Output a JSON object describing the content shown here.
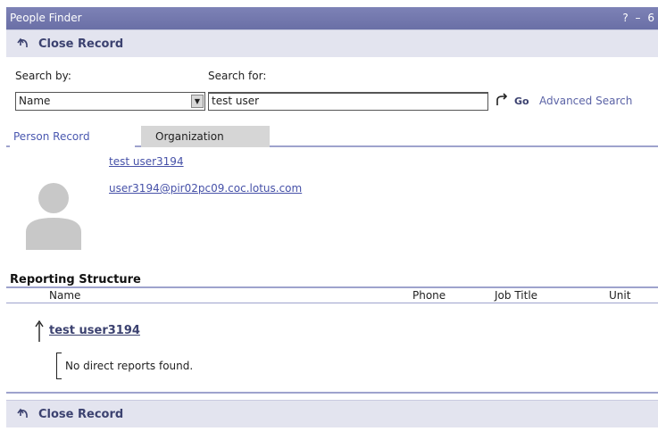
{
  "window": {
    "title": "People Finder",
    "controls": "? – 6"
  },
  "close_record": {
    "label": "Close Record"
  },
  "search": {
    "by_label": "Search by:",
    "for_label": "Search for:",
    "by_value": "Name",
    "for_value": "test user",
    "go_label": "Go",
    "advanced_label": "Advanced Search"
  },
  "tabs": [
    {
      "label": "Person Record",
      "active": true
    },
    {
      "label": "Organization",
      "active": false
    }
  ],
  "person": {
    "name": "test user3194",
    "email": "user3194@pir02pc09.coc.lotus.com"
  },
  "reporting": {
    "title": "Reporting Structure",
    "columns": [
      "Name",
      "Phone",
      "Job Title",
      "Unit"
    ],
    "manager_name": "test user3194",
    "empty_message": "No direct reports found."
  },
  "colors": {
    "accent": "#6a6fa6",
    "link": "#4651a8",
    "bar": "#e3e4ef"
  }
}
